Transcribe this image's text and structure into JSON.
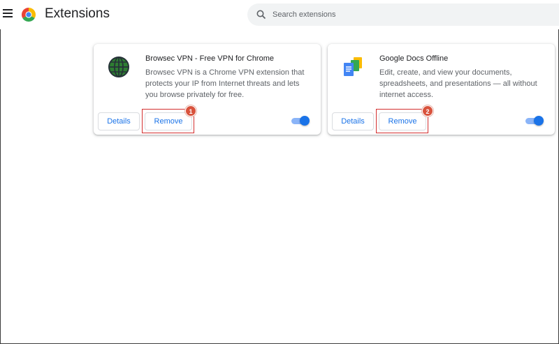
{
  "header": {
    "title": "Extensions",
    "search_placeholder": "Search extensions"
  },
  "colors": {
    "accent": "#1a73e8",
    "highlight": "#d32f2f",
    "badge": "#d9533d"
  },
  "extensions": [
    {
      "name": "Browsec VPN - Free VPN for Chrome",
      "description": "Browsec VPN is a Chrome VPN extension that protects your IP from Internet threats and lets you browse privately for free.",
      "icon": "globe-icon",
      "details_label": "Details",
      "remove_label": "Remove",
      "enabled": true,
      "badge": "1"
    },
    {
      "name": "Google Docs Offline",
      "description": "Edit, create, and view your documents, spreadsheets, and presentations — all without internet access.",
      "icon": "google-docs-icon",
      "details_label": "Details",
      "remove_label": "Remove",
      "enabled": true,
      "badge": "2"
    }
  ]
}
